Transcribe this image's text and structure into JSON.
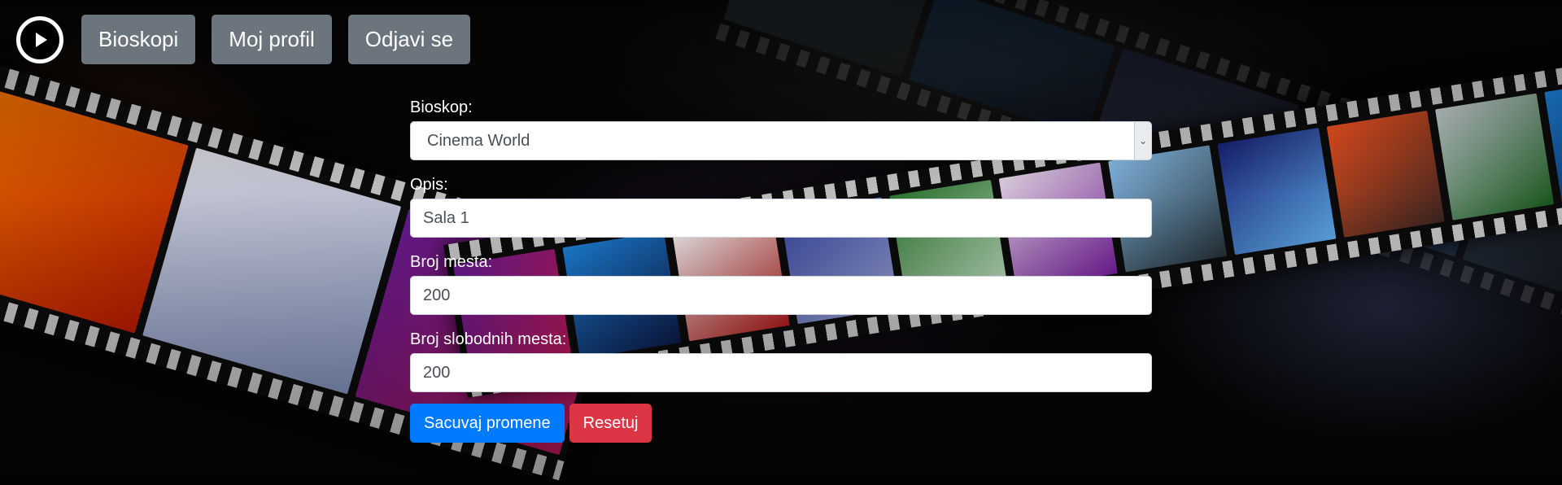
{
  "navbar": {
    "logo_icon": "play-circle-icon",
    "buttons": [
      {
        "label": "Bioskopi"
      },
      {
        "label": "Moj profil"
      },
      {
        "label": "Odjavi se"
      }
    ]
  },
  "form": {
    "cinema": {
      "label": "Bioskop:",
      "selected": "Cinema World"
    },
    "description": {
      "label": "Opis:",
      "value": "Sala 1"
    },
    "seats": {
      "label": "Broj mesta:",
      "value": "200"
    },
    "free_seats": {
      "label": "Broj slobodnih mesta:",
      "value": "200"
    },
    "save_label": "Sacuvaj promene",
    "reset_label": "Resetuj"
  },
  "colors": {
    "nav_button": "#6c757d",
    "primary": "#007bff",
    "danger": "#dc3545"
  }
}
